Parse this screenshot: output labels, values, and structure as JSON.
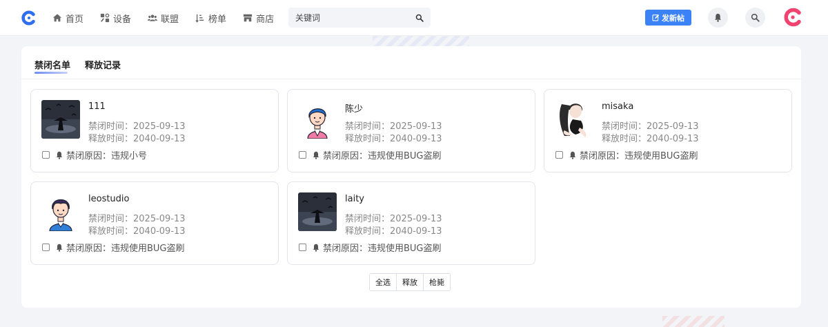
{
  "nav": {
    "items": [
      {
        "label": "首页",
        "icon": "home-icon"
      },
      {
        "label": "设备",
        "icon": "devices-icon"
      },
      {
        "label": "联盟",
        "icon": "users-icon"
      },
      {
        "label": "榜单",
        "icon": "ranking-icon"
      },
      {
        "label": "商店",
        "icon": "store-icon"
      }
    ],
    "search_placeholder": "关键词",
    "post_button": "发新帖"
  },
  "tabs": [
    {
      "label": "禁闭名单",
      "active": true
    },
    {
      "label": "释放记录",
      "active": false
    }
  ],
  "cards": [
    {
      "name": "111",
      "ban_label": "禁闭时间：",
      "ban_time": "2025-09-13",
      "release_label": "释放时间：",
      "release_time": "2040-09-13",
      "reason": "禁闭原因：违规小号",
      "avatar": "dark-scene"
    },
    {
      "name": "陈少",
      "ban_label": "禁闭时间：",
      "ban_time": "2025-09-13",
      "release_label": "释放时间：",
      "release_time": "2040-09-13",
      "reason": "禁闭原因：违规使用BUG盗刷",
      "avatar": "cartoon-boy-pink"
    },
    {
      "name": "misaka",
      "ban_label": "禁闭时间：",
      "ban_time": "2025-09-13",
      "release_label": "释放时间：",
      "release_time": "2040-09-13",
      "reason": "禁闭原因：违规使用BUG盗刷",
      "avatar": "anime-girl"
    },
    {
      "name": "leostudio",
      "ban_label": "禁闭时间：",
      "ban_time": "2025-09-13",
      "release_label": "释放时间：",
      "release_time": "2040-09-13",
      "reason": "禁闭原因：违规使用BUG盗刷",
      "avatar": "cartoon-man-blue"
    },
    {
      "name": "laity",
      "ban_label": "禁闭时间：",
      "ban_time": "2025-09-13",
      "release_label": "释放时间：",
      "release_time": "2040-09-13",
      "reason": "禁闭原因：违规使用BUG盗刷",
      "avatar": "dark-scene"
    }
  ],
  "actions": [
    "全选",
    "释放",
    "枪毙"
  ],
  "colors": {
    "accent": "#3b82f6",
    "logo": "#2f6fed",
    "user_logo": "#f0436f"
  }
}
